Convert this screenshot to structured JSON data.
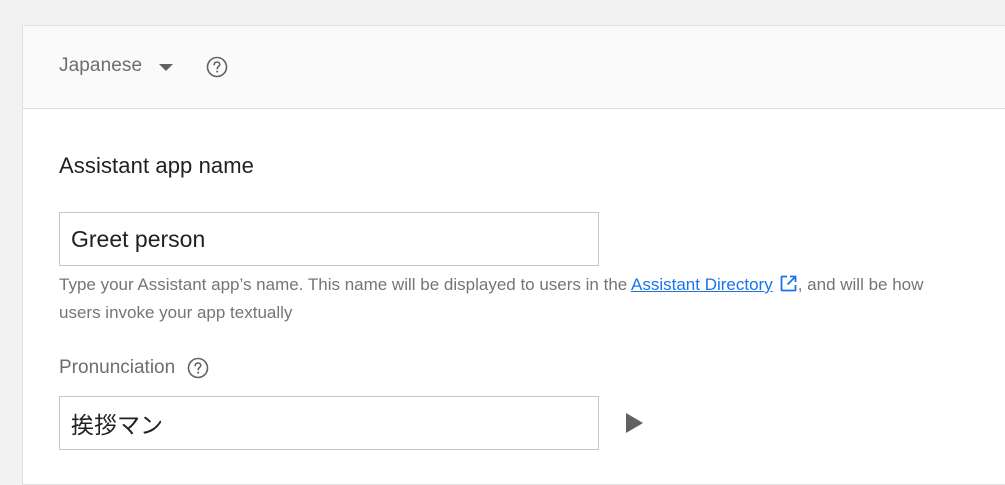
{
  "header": {
    "language_selected": "Japanese",
    "language_dropdown_icon": "caret-down-icon",
    "help_icon": "help-circle-icon"
  },
  "app_name": {
    "title": "Assistant app name",
    "value": "Greet person",
    "helper_before": "Type your Assistant app’s name. This name will be displayed to users in the ",
    "helper_link": "Assistant Directory",
    "helper_link_icon": "open-in-new-icon",
    "helper_after": ", and will be how users invoke your app textually"
  },
  "pronunciation": {
    "label": "Pronunciation",
    "help_icon": "help-circle-icon",
    "value": "挨拶マン",
    "play_icon": "play-icon"
  },
  "colors": {
    "link": "#1a73e8",
    "text_primary": "#212121",
    "text_secondary": "#757575",
    "icon": "#616161"
  }
}
